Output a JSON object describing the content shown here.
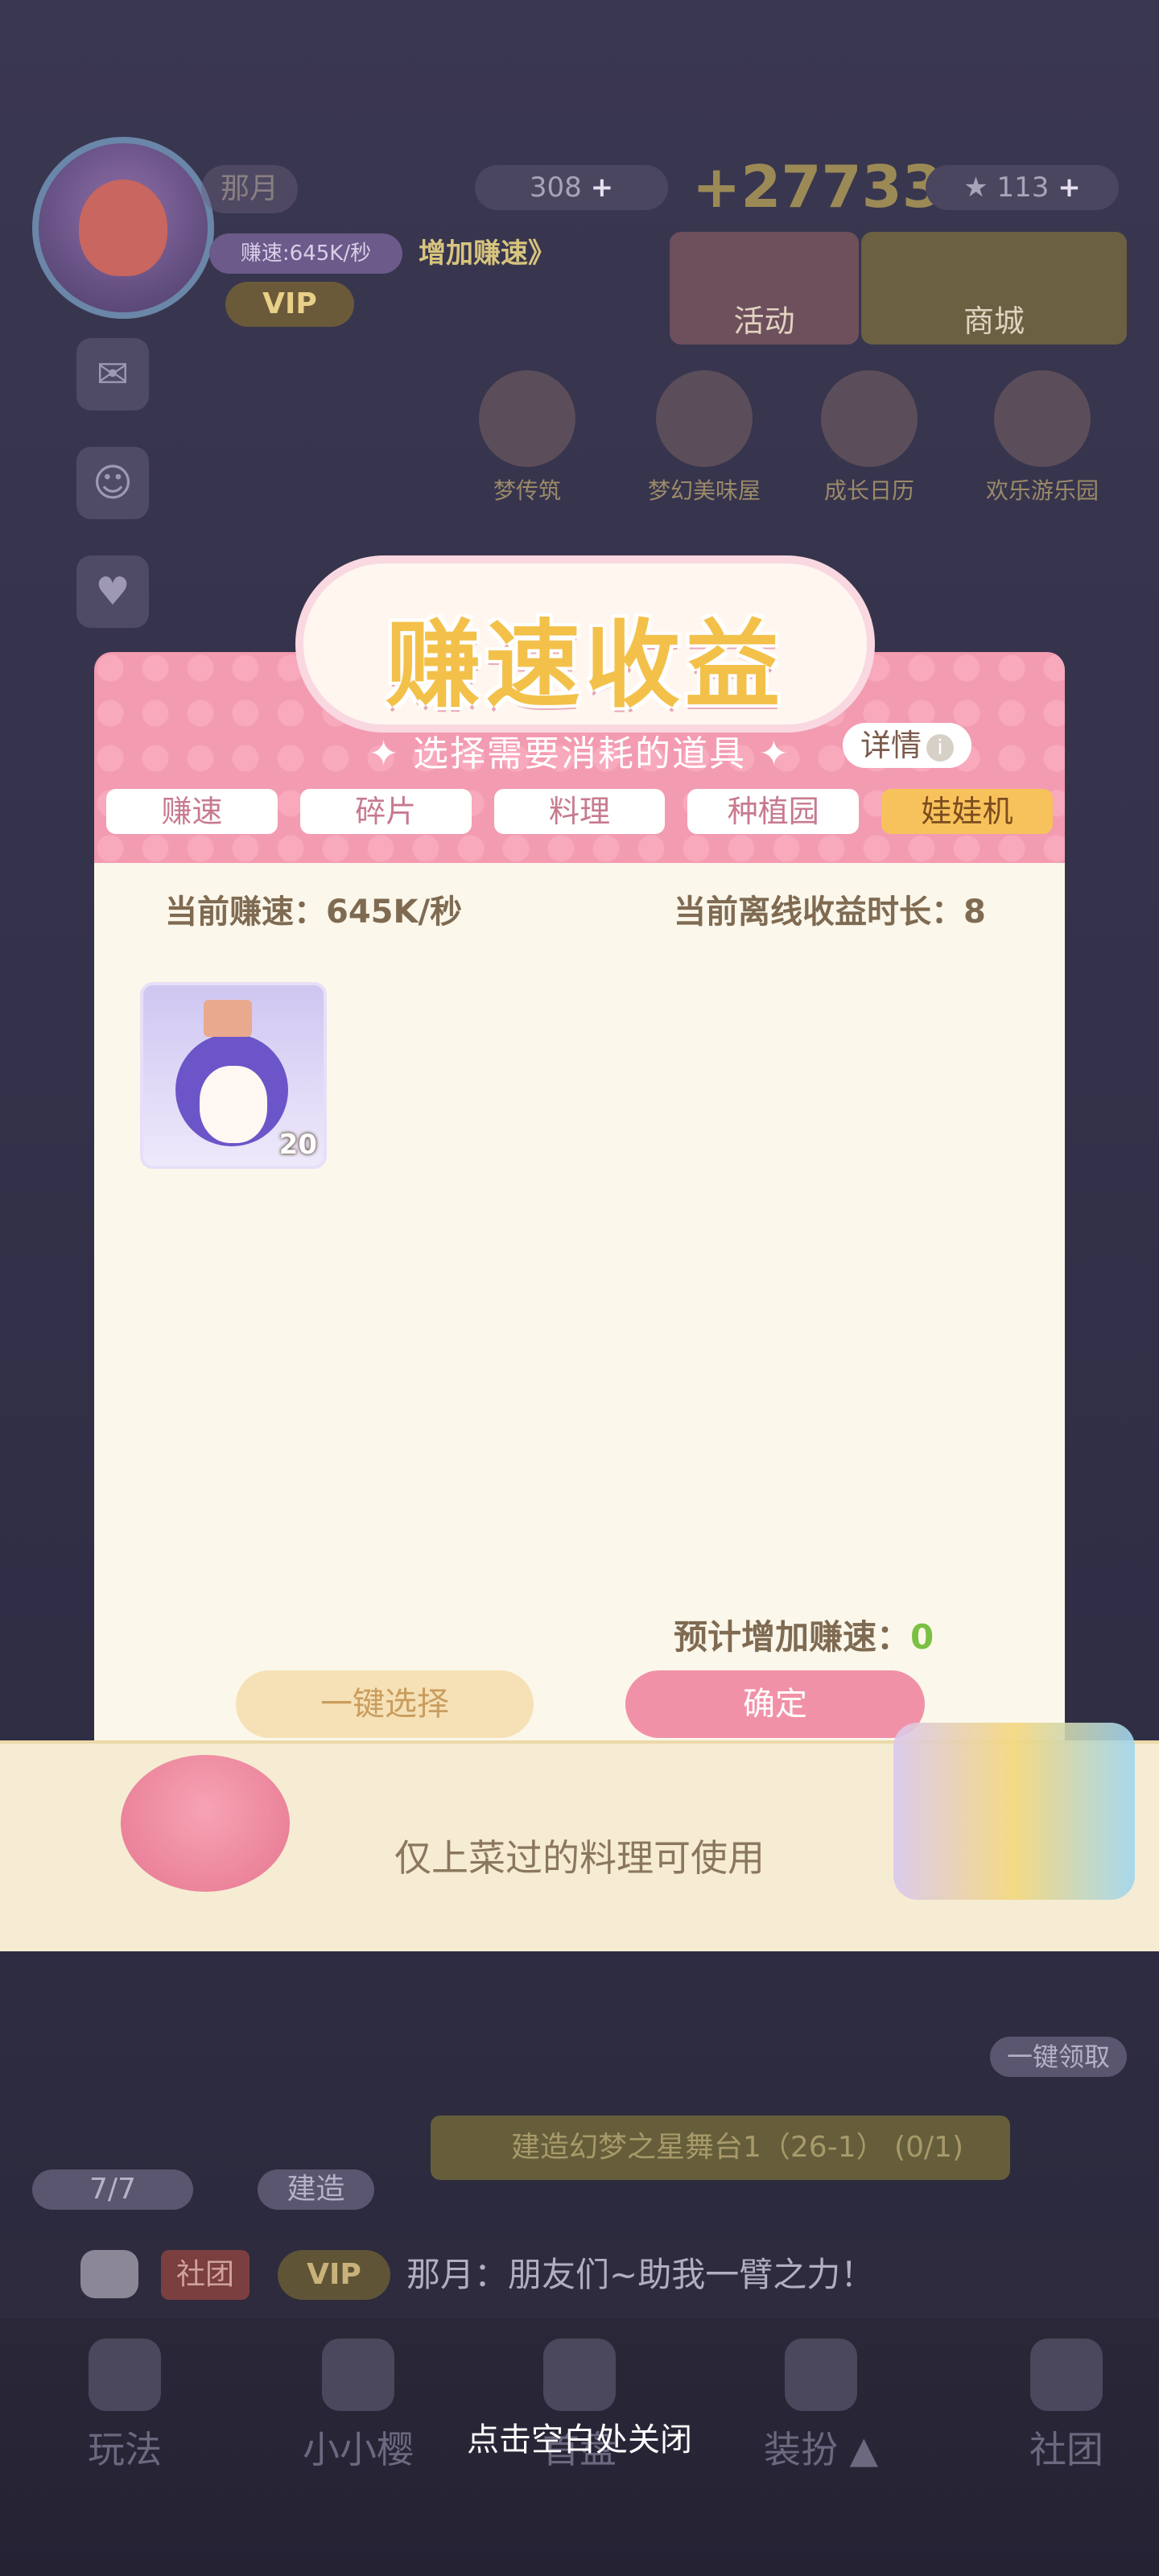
{
  "hud": {
    "player_name": "那月",
    "speed_text": "赚速:645K/秒",
    "speed_up_label": "增加赚速》",
    "vip_label": "VIP",
    "gems": "308",
    "gold": "+27733",
    "stars": "113",
    "plus": "+",
    "activity_label": "活动",
    "shop_label": "商城",
    "top_activities": [
      "梦传筑",
      "梦幻美味屋",
      "成长日历",
      "欢乐游乐园"
    ]
  },
  "modal": {
    "title": "赚速收益",
    "subtitle": "✦  选择需要消耗的道具  ✦",
    "detail_label": "详情",
    "detail_icon": "i",
    "tabs": [
      {
        "label": "赚速",
        "active": false
      },
      {
        "label": "碎片",
        "active": false
      },
      {
        "label": "料理",
        "active": false
      },
      {
        "label": "种植园",
        "active": false
      },
      {
        "label": "娃娃机",
        "active": true
      }
    ],
    "current_speed": "当前赚速：645K/秒",
    "offline_duration": "当前离线收益时长：8",
    "items": [
      {
        "name_icon": "penguin-doll-icon",
        "count": "20"
      }
    ],
    "predict_label": "预计增加赚速：",
    "predict_value": "0",
    "select_all_label": "一键选择",
    "confirm_label": "确定",
    "footer_note": "仅上菜过的料理可使用"
  },
  "bottom": {
    "claim_label": "一键领取",
    "gift_counter": "7/7",
    "build_label": "建造",
    "build_task": "建造幻梦之星舞台1（26-1）    (0/1)",
    "chat_club": "社团",
    "chat_vip": "VIP",
    "chat_message": "那月：朋友们~助我一臂之力！",
    "nav": [
      "玩法",
      "小小樱",
      "首盘",
      "装扮 ▲",
      "社团"
    ],
    "close_hint": "点击空白处关闭"
  },
  "colors": {
    "accent_pink": "#f191a7",
    "tab_active": "#f7c25b",
    "predict_green": "#7ac142"
  }
}
